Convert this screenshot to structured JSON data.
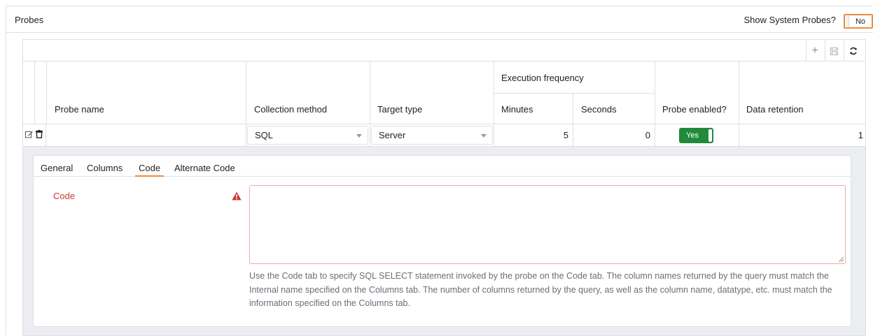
{
  "header": {
    "title": "Probes",
    "show_system_label": "Show System Probes?",
    "show_system_value": "No"
  },
  "toolbar": {
    "add_icon": "+",
    "save_icon": "🖫",
    "refresh_icon": "↻"
  },
  "table": {
    "group_header": "Execution frequency",
    "columns": {
      "probe_name": "Probe name",
      "collection_method": "Collection method",
      "target_type": "Target type",
      "minutes": "Minutes",
      "seconds": "Seconds",
      "probe_enabled": "Probe enabled?",
      "data_retention": "Data retention"
    },
    "row": {
      "probe_name": "",
      "collection_method": "SQL",
      "target_type": "Server",
      "minutes": "5",
      "seconds": "0",
      "probe_enabled": "Yes",
      "data_retention": "1"
    }
  },
  "detail": {
    "tabs": [
      "General",
      "Columns",
      "Code",
      "Alternate Code"
    ],
    "active_tab": "Code",
    "code_label": "Code",
    "code_value": "",
    "help_text": "Use the Code tab to specify SQL SELECT statement invoked by the probe on the Code tab. The column names returned by the query must match the Internal name specified on the Columns tab. The number of columns returned by the query, as well as the column name, datatype, etc. must match the information specified on the Columns tab."
  },
  "colors": {
    "accent": "#f08a3c",
    "error": "#d0342c",
    "enabled_green": "#228b3a",
    "border": "#dde0e6"
  }
}
